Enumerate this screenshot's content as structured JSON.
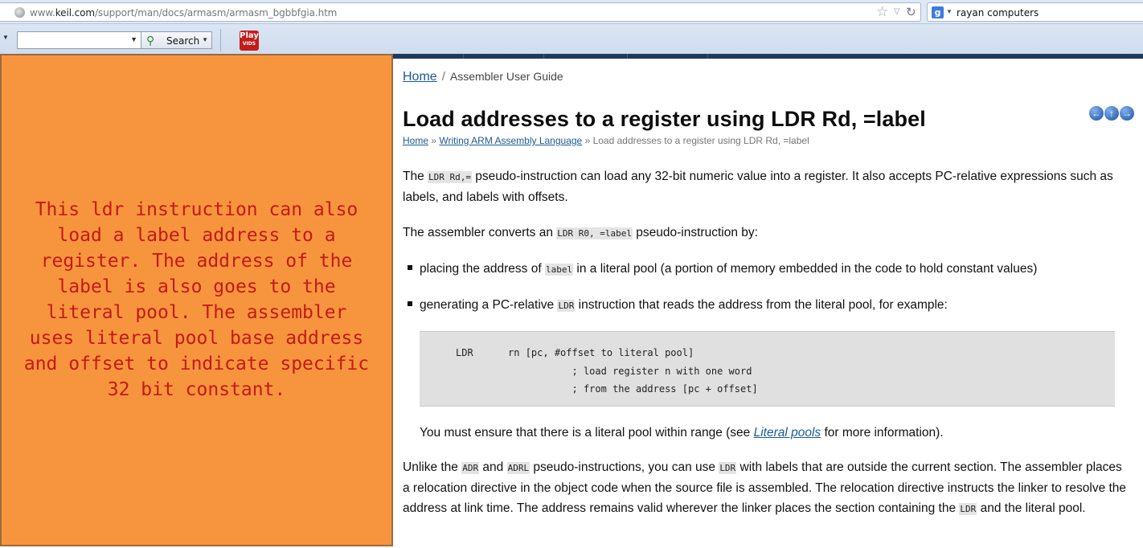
{
  "browser": {
    "url_prefix": "www.",
    "url_domain": "keil.com",
    "url_path": "/support/man/docs/armasm/armasm_bgbbfgia.htm",
    "search_engine_icon": "g-icon",
    "search_query": "rayan computers"
  },
  "toolbar": {
    "search_value": "",
    "search_label": "Search",
    "playvids_line1": "Play",
    "playvids_line2": "VIDS"
  },
  "overlay": {
    "color": "#f7953f",
    "text_color": "#c41a16",
    "text": "This ldr instruction can also\nload a label address to a\nregister. The address of the\nlabel is also goes to the\nliteral pool. The assembler\nuses literal pool base address\nand offset to indicate specific\n32 bit constant."
  },
  "page": {
    "breadcrumb": {
      "home": "Home",
      "separator": "/",
      "current": "Assembler User Guide"
    },
    "title": "Load addresses to a register using LDR Rd, =label",
    "subcrumb": {
      "home": "Home",
      "sep": " » ",
      "section": "Writing ARM Assembly Language",
      "current": "Load addresses to a register using LDR Rd, =label"
    },
    "p1": {
      "a": "The ",
      "code": "LDR Rd,=",
      "b": " pseudo-instruction can load any 32-bit numeric value into a register. It also accepts PC-relative expressions such as labels, and labels with offsets."
    },
    "p2": {
      "a": "The assembler converts an ",
      "code": "LDR R0, =label",
      "b": " pseudo-instruction by:"
    },
    "bullet1": {
      "a": "placing the address of ",
      "code": "label",
      "b": " in a literal pool (a portion of memory embedded in the code to hold constant values)"
    },
    "bullet2": {
      "a": "generating a PC-relative ",
      "code": "LDR",
      "b": " instruction that reads the address from the literal pool, for example:"
    },
    "code_block": "LDR      rn [pc, #offset to literal pool]\n                    ; load register n with one word\n                    ; from the address [pc + offset]",
    "note": {
      "a": "You must ensure that there is a literal pool within range (see ",
      "link": "Literal pools",
      "b": " for more information)."
    },
    "p3": {
      "a": "Unlike the ",
      "c1": "ADR",
      "b": " and ",
      "c2": "ADRL",
      "c": " pseudo-instructions, you can use ",
      "c3": "LDR",
      "d": " with labels that are outside the current section. The assembler places a relocation directive in the object code when the source file is assembled. The relocation directive instructs the linker to resolve the address at link time. The address remains valid wherever the linker places the section containing the ",
      "c4": "LDR",
      "e": " and the literal pool."
    }
  }
}
